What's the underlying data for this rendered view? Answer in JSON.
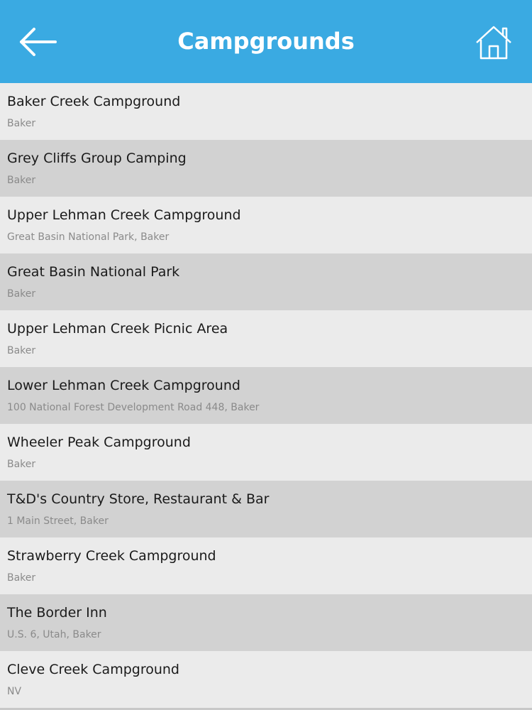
{
  "header": {
    "title": "Campgrounds",
    "back_icon": "arrow-left-icon",
    "home_icon": "home-icon",
    "background_color": "#3aaae2"
  },
  "list": {
    "row_colors": [
      "#ebebeb",
      "#d2d2d2"
    ],
    "items": [
      {
        "name": "Baker Creek Campground",
        "sub": "Baker"
      },
      {
        "name": "Grey Cliffs Group Camping",
        "sub": "Baker"
      },
      {
        "name": "Upper Lehman Creek Campground",
        "sub": "Great Basin National Park, Baker"
      },
      {
        "name": "Great Basin National Park",
        "sub": "Baker"
      },
      {
        "name": "Upper Lehman Creek Picnic Area",
        "sub": "Baker"
      },
      {
        "name": "Lower Lehman Creek Campground",
        "sub": "100 National Forest Development Road 448, Baker"
      },
      {
        "name": "Wheeler Peak Campground",
        "sub": "Baker"
      },
      {
        "name": "T&D's Country Store, Restaurant & Bar",
        "sub": "1 Main Street, Baker"
      },
      {
        "name": "Strawberry Creek Campground",
        "sub": "Baker"
      },
      {
        "name": "The Border Inn",
        "sub": "U.S. 6, Utah, Baker"
      },
      {
        "name": "Cleve Creek Campground",
        "sub": "NV"
      }
    ]
  }
}
